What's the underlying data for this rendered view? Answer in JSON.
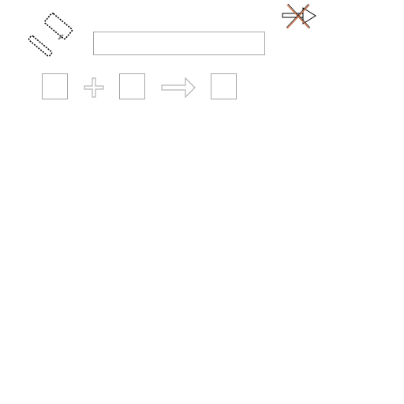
{
  "anvil": {
    "title_icon": "hammer-icon",
    "name_field": {
      "value": "",
      "placeholder": ""
    },
    "status_icon": "crossed-arrow-icon",
    "slots": [
      {
        "role": "input-1",
        "item": ""
      },
      {
        "role": "input-2",
        "item": ""
      },
      {
        "role": "output",
        "item": ""
      }
    ],
    "operator_icon": "plus-icon",
    "result_icon": "arrow-right-icon"
  },
  "colors": {
    "border": "#a6a6a6",
    "cross": "#c8734e",
    "icon": "#000000"
  }
}
